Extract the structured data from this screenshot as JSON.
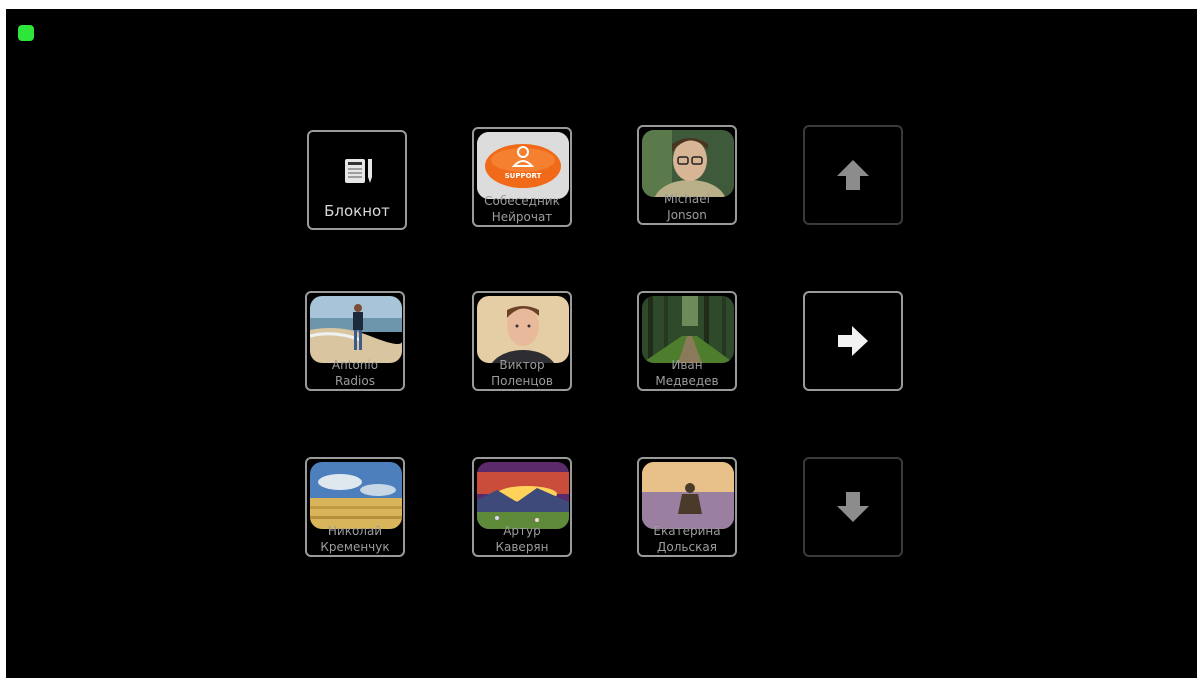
{
  "status": {
    "color": "#2ee53a"
  },
  "tiles": {
    "notebook": {
      "label": "Блокнот",
      "icon": "notebook-icon"
    },
    "support": {
      "line1": "Собеседник",
      "line2": "Нейрочат",
      "badge": "SUPPORT"
    },
    "michael": {
      "line1": "Michael",
      "line2": "Jonson"
    },
    "antonio": {
      "line1": "Antonio",
      "line2": "Radios"
    },
    "viktor": {
      "line1": "Виктор",
      "line2": "Поленцов"
    },
    "ivan": {
      "line1": "Иван",
      "line2": "Медведев"
    },
    "nikolai": {
      "line1": "Николай",
      "line2": "Кременчук"
    },
    "artur": {
      "line1": "Артур",
      "line2": "Каверян"
    },
    "ekaterina": {
      "line1": "Екатерина",
      "line2": "Дольская"
    }
  },
  "nav": {
    "up": "arrow-up-icon",
    "right": "arrow-right-icon",
    "down": "arrow-down-icon"
  }
}
